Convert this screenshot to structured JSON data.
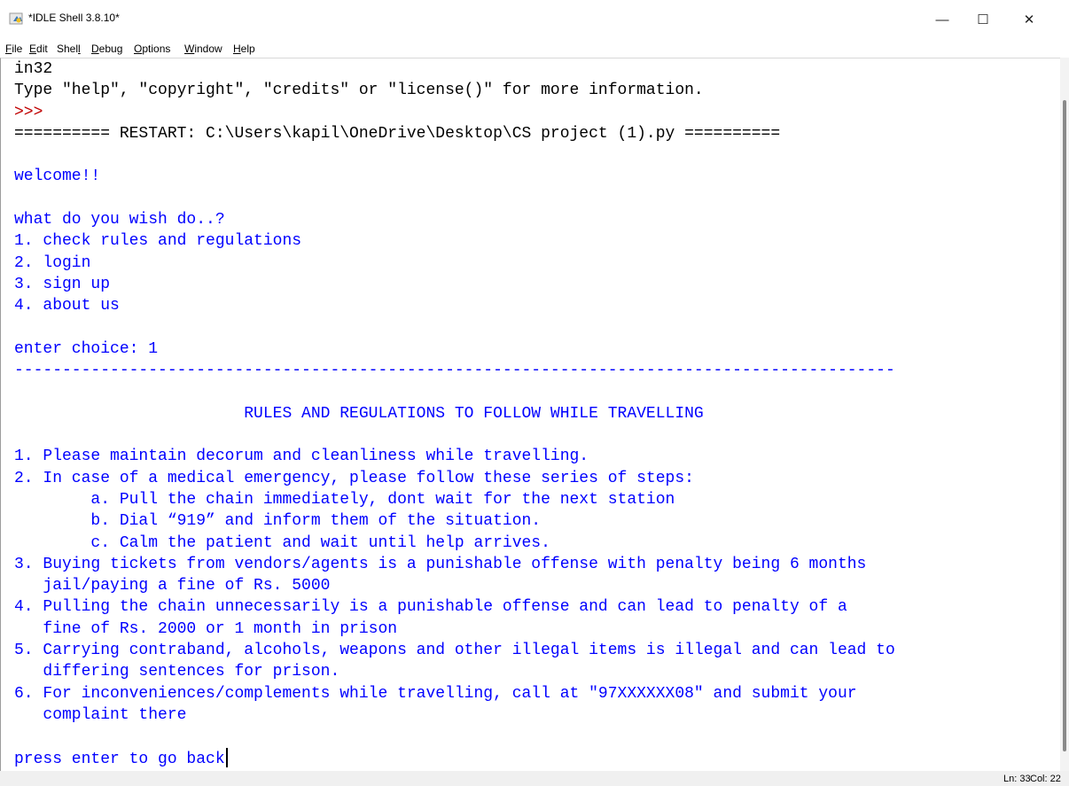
{
  "window": {
    "title": "*IDLE Shell 3.8.10*",
    "icon": "python-idle-icon",
    "controls": {
      "minimize": "—",
      "maximize": "☐",
      "close": "✕"
    }
  },
  "menubar": {
    "items": [
      {
        "first": "F",
        "rest": "ile"
      },
      {
        "first": "E",
        "rest": "dit"
      },
      {
        "first": "Shel",
        "u": "l",
        "rest": ""
      },
      {
        "first": "D",
        "rest": "ebug"
      },
      {
        "first": "O",
        "rest": "ptions"
      },
      {
        "first": "W",
        "rest": "indow"
      },
      {
        "first": "H",
        "rest": "elp"
      }
    ]
  },
  "shell": {
    "lines": [
      {
        "text": "in32",
        "style": "std"
      },
      {
        "text": "Type \"help\", \"copyright\", \"credits\" or \"license()\" for more information.",
        "style": "std"
      },
      {
        "text": ">>> ",
        "style": "prompt"
      },
      {
        "text": "========== RESTART: C:\\Users\\kapil\\OneDrive\\Desktop\\CS project (1).py ==========",
        "style": "std"
      },
      {
        "text": "",
        "style": "out"
      },
      {
        "text": "welcome!!",
        "style": "out"
      },
      {
        "text": "",
        "style": "out"
      },
      {
        "text": "what do you wish do..?",
        "style": "out"
      },
      {
        "text": "1. check rules and regulations",
        "style": "out"
      },
      {
        "text": "2. login",
        "style": "out"
      },
      {
        "text": "3. sign up",
        "style": "out"
      },
      {
        "text": "4. about us",
        "style": "out"
      },
      {
        "text": "",
        "style": "out"
      },
      {
        "text": "enter choice: ",
        "style": "out",
        "input": "1"
      },
      {
        "text": "--------------------------------------------------------------------------------------------",
        "style": "out"
      },
      {
        "text": "",
        "style": "out"
      },
      {
        "text": "                        RULES AND REGULATIONS TO FOLLOW WHILE TRAVELLING",
        "style": "out"
      },
      {
        "text": "",
        "style": "out"
      },
      {
        "text": "1. Please maintain decorum and cleanliness while travelling.",
        "style": "out"
      },
      {
        "text": "2. In case of a medical emergency, please follow these series of steps:",
        "style": "out"
      },
      {
        "text": "        a. Pull the chain immediately, dont wait for the next station",
        "style": "out"
      },
      {
        "text": "        b. Dial “919” and inform them of the situation.",
        "style": "out"
      },
      {
        "text": "        c. Calm the patient and wait until help arrives.",
        "style": "out"
      },
      {
        "text": "3. Buying tickets from vendors/agents is a punishable offense with penalty being 6 months",
        "style": "out"
      },
      {
        "text": "   jail/paying a fine of Rs. 5000",
        "style": "out"
      },
      {
        "text": "4. Pulling the chain unnecessarily is a punishable offense and can lead to penalty of a",
        "style": "out"
      },
      {
        "text": "   fine of Rs. 2000 or 1 month in prison",
        "style": "out"
      },
      {
        "text": "5. Carrying contraband, alcohols, weapons and other illegal items is illegal and can lead to",
        "style": "out"
      },
      {
        "text": "   differing sentences for prison.",
        "style": "out"
      },
      {
        "text": "6. For inconveniences/complements while travelling, call at \"97XXXXXX08\" and submit your",
        "style": "out"
      },
      {
        "text": "   complaint there",
        "style": "out"
      },
      {
        "text": "",
        "style": "out"
      },
      {
        "text": "press enter to go back",
        "style": "out",
        "cursor": true
      }
    ]
  },
  "status": {
    "ln": "Ln: 33",
    "col": "Col: 22"
  },
  "colors": {
    "output": "#0000ff",
    "prompt": "#c00000",
    "stdout": "#000000"
  }
}
